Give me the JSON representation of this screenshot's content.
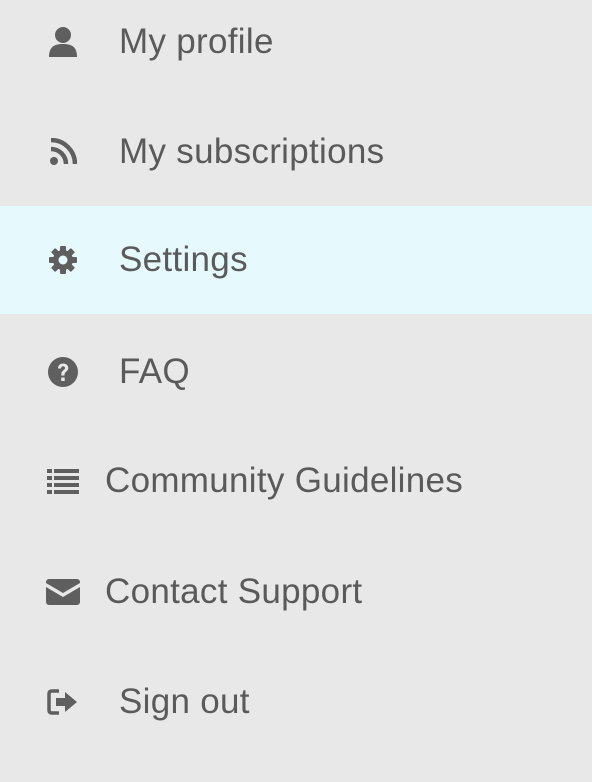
{
  "menu": {
    "items": [
      {
        "label": "My profile",
        "icon": "user-icon"
      },
      {
        "label": "My subscriptions",
        "icon": "rss-icon"
      },
      {
        "label": "Settings",
        "icon": "gear-icon",
        "active": true
      },
      {
        "label": "FAQ",
        "icon": "question-circle-icon"
      },
      {
        "label": "Community Guidelines",
        "icon": "list-icon"
      },
      {
        "label": "Contact Support",
        "icon": "envelope-icon"
      },
      {
        "label": "Sign out",
        "icon": "sign-out-icon"
      }
    ]
  },
  "colors": {
    "background": "#e8e8e8",
    "active_background": "#e6f9fd",
    "text": "#5a5a5a",
    "icon": "#5f5f5f"
  }
}
